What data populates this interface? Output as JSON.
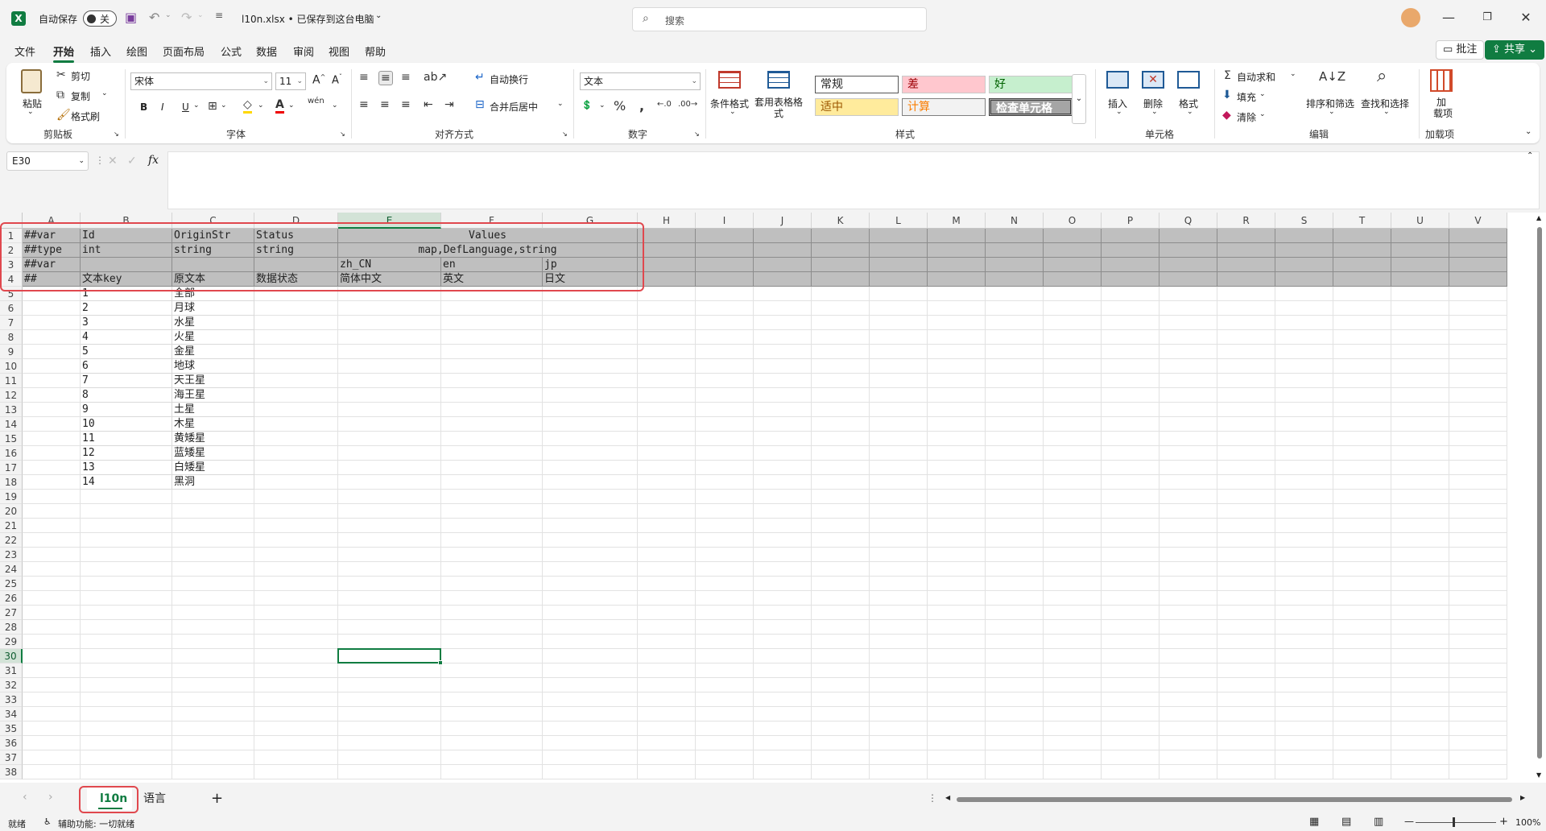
{
  "titlebar": {
    "autosave_label": "自动保存",
    "autosave_state": "关",
    "file_title": "l10n.xlsx • 已保存到这台电脑",
    "search_placeholder": "搜索"
  },
  "menu": {
    "tabs": [
      "文件",
      "开始",
      "插入",
      "绘图",
      "页面布局",
      "公式",
      "数据",
      "审阅",
      "视图",
      "帮助"
    ],
    "active": "开始",
    "comment_btn": "批注",
    "share_btn": "共享"
  },
  "ribbon": {
    "clipboard": {
      "paste": "粘贴",
      "cut": "剪切",
      "copy": "复制",
      "format_painter": "格式刷",
      "label": "剪贴板"
    },
    "font": {
      "name": "宋体",
      "size": "11",
      "label": "字体",
      "bold": "B",
      "italic": "I",
      "underline": "U"
    },
    "alignment": {
      "wrap": "自动换行",
      "merge": "合并后居中",
      "label": "对齐方式"
    },
    "number": {
      "format": "文本",
      "label": "数字"
    },
    "styles": {
      "conditional": "条件格式",
      "table_format": "套用表格格式",
      "label": "样式",
      "cells": [
        "常规",
        "差",
        "好",
        "适中",
        "计算",
        "检查单元格"
      ]
    },
    "cells": {
      "insert": "插入",
      "delete": "删除",
      "format": "格式",
      "label": "单元格"
    },
    "editing": {
      "autosum": "自动求和",
      "fill": "填充",
      "clear": "清除",
      "sort": "排序和筛选",
      "find": "查找和选择",
      "label": "编辑"
    },
    "addins": {
      "addin": "加载项",
      "addin_top": "加",
      "addin_bottom": "载项",
      "label": "加载项"
    }
  },
  "formula_bar": {
    "name_box": "E30",
    "fx": "fx",
    "content": ""
  },
  "grid": {
    "columns": [
      "A",
      "B",
      "C",
      "D",
      "E",
      "F",
      "G",
      "H",
      "I",
      "J",
      "K",
      "L",
      "M",
      "N",
      "O",
      "P",
      "Q",
      "R",
      "S",
      "T",
      "U",
      "V"
    ],
    "selected_col": "E",
    "selected_row": 30,
    "header_rows": [
      [
        "##var",
        "Id",
        "OriginStr",
        "Status",
        "Values"
      ],
      [
        "##type",
        "int",
        "string",
        "string",
        "map,DefLanguage,string"
      ],
      [
        "##var",
        "",
        "",
        "",
        "zh_CN",
        "en",
        "jp"
      ],
      [
        "##",
        "文本key",
        "原文本",
        "数据状态",
        "简体中文",
        "英文",
        "日文"
      ]
    ],
    "data_rows": [
      [
        "1",
        "全部"
      ],
      [
        "2",
        "月球"
      ],
      [
        "3",
        "水星"
      ],
      [
        "4",
        "火星"
      ],
      [
        "5",
        "金星"
      ],
      [
        "6",
        "地球"
      ],
      [
        "7",
        "天王星"
      ],
      [
        "8",
        "海王星"
      ],
      [
        "9",
        "土星"
      ],
      [
        "10",
        "木星"
      ],
      [
        "11",
        "黄矮星"
      ],
      [
        "12",
        "蓝矮星"
      ],
      [
        "13",
        "白矮星"
      ],
      [
        "14",
        "黑洞"
      ]
    ],
    "row_count": 38
  },
  "sheets": {
    "tabs": [
      "l10n",
      "语言"
    ],
    "active": "l10n",
    "add": "+"
  },
  "status": {
    "ready": "就绪",
    "accessibility": "辅助功能: 一切就绪",
    "zoom": "100%"
  },
  "colors": {
    "accent": "#107c41",
    "header_fill": "#bfbfbf",
    "highlight": "#e0484e",
    "bad": "#ffc7ce",
    "good": "#c6efce",
    "neutral": "#ffeb9c"
  }
}
